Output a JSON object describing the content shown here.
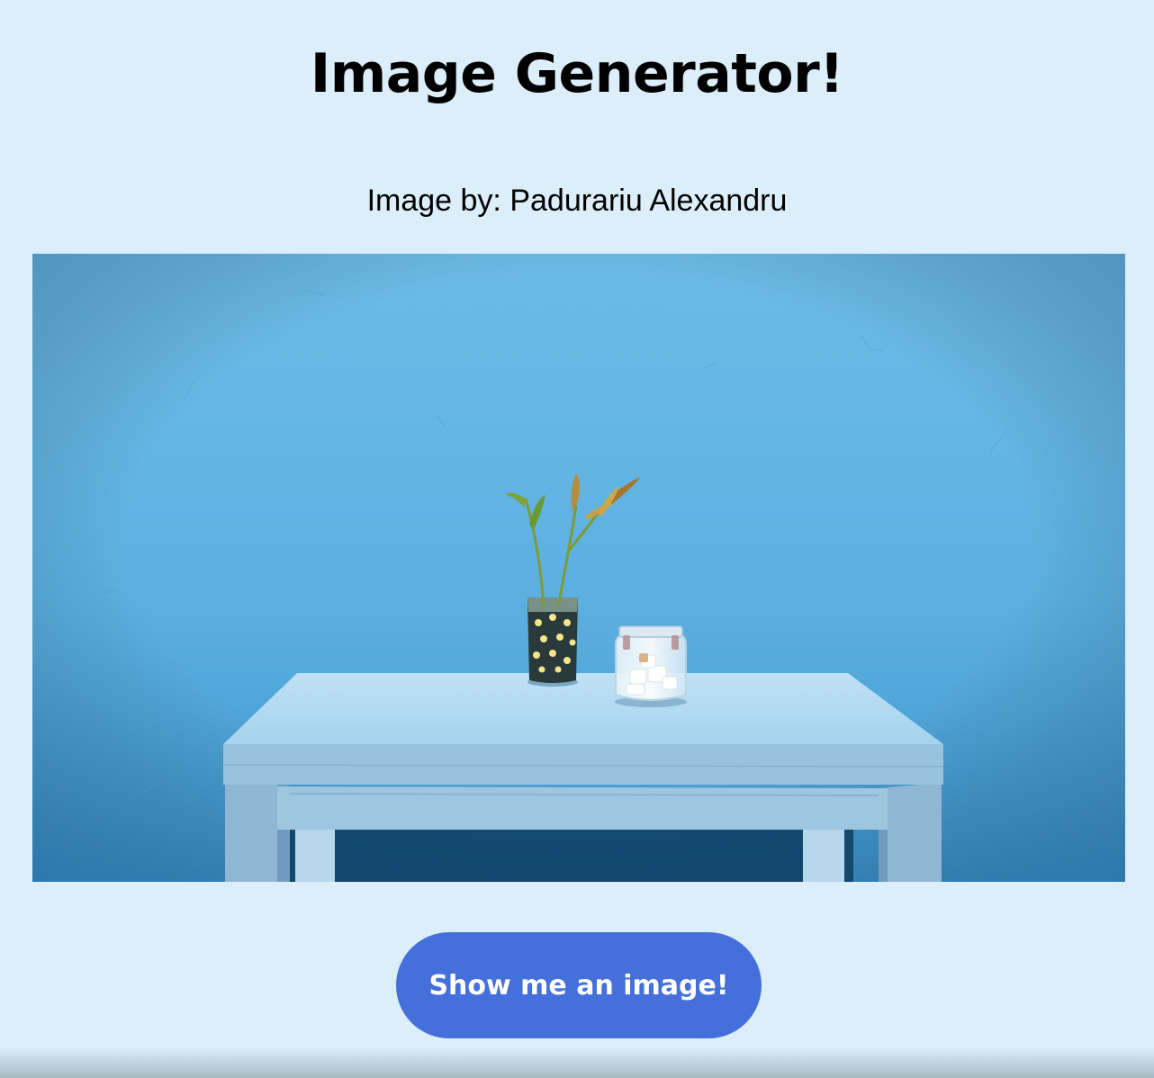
{
  "header": {
    "title": "Image Generator!"
  },
  "credit": {
    "text": "Image by: Padurariu Alexandru"
  },
  "photo": {
    "alt": "Light blue table with a small plant in a flowered glass and a glass jar against a blue wall"
  },
  "actions": {
    "show_label": "Show me an image!"
  },
  "colors": {
    "background": "#dbeef9",
    "button": "#456fdb",
    "wall": "#5fb2e0",
    "table": "#a9d4ee"
  }
}
